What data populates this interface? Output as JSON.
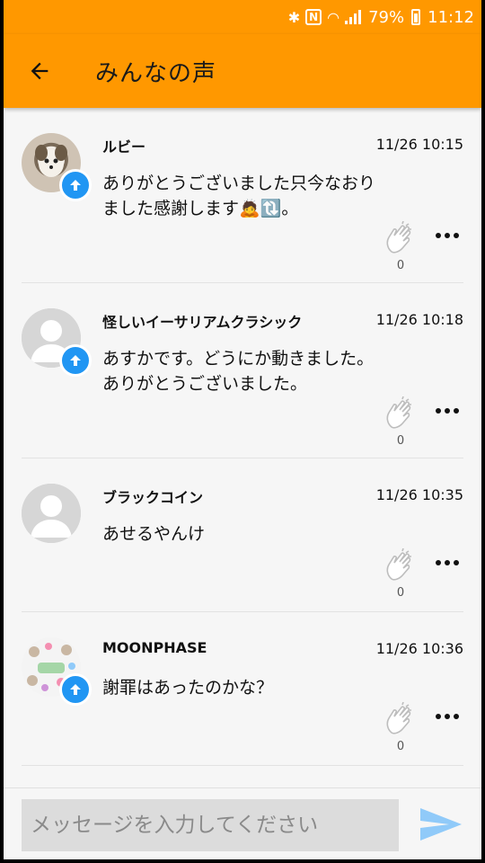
{
  "status": {
    "battery": "79%",
    "time": "11:12"
  },
  "header": {
    "title": "みんなの声"
  },
  "posts": [
    {
      "author": "ルビー",
      "time": "11/26 10:15",
      "message": "ありがとうございました只今なおりました感謝します🙇🔃。",
      "claps": "0"
    },
    {
      "author": "怪しいイーサリアムクラシック",
      "time": "11/26 10:18",
      "message": "あすかです。どうにか動きました。ありがとうございました。",
      "claps": "0"
    },
    {
      "author": "ブラックコイン",
      "time": "11/26 10:35",
      "message": "あせるやんけ",
      "claps": "0"
    },
    {
      "author": "MOONPHASE",
      "time": "11/26 10:36",
      "message": "謝罪はあったのかな？",
      "claps": "0"
    }
  ],
  "composer": {
    "placeholder": "メッセージを入力してください"
  },
  "colors": {
    "app_bar": "#ff9800",
    "badge": "#2196f3",
    "send": "#90caf9"
  }
}
